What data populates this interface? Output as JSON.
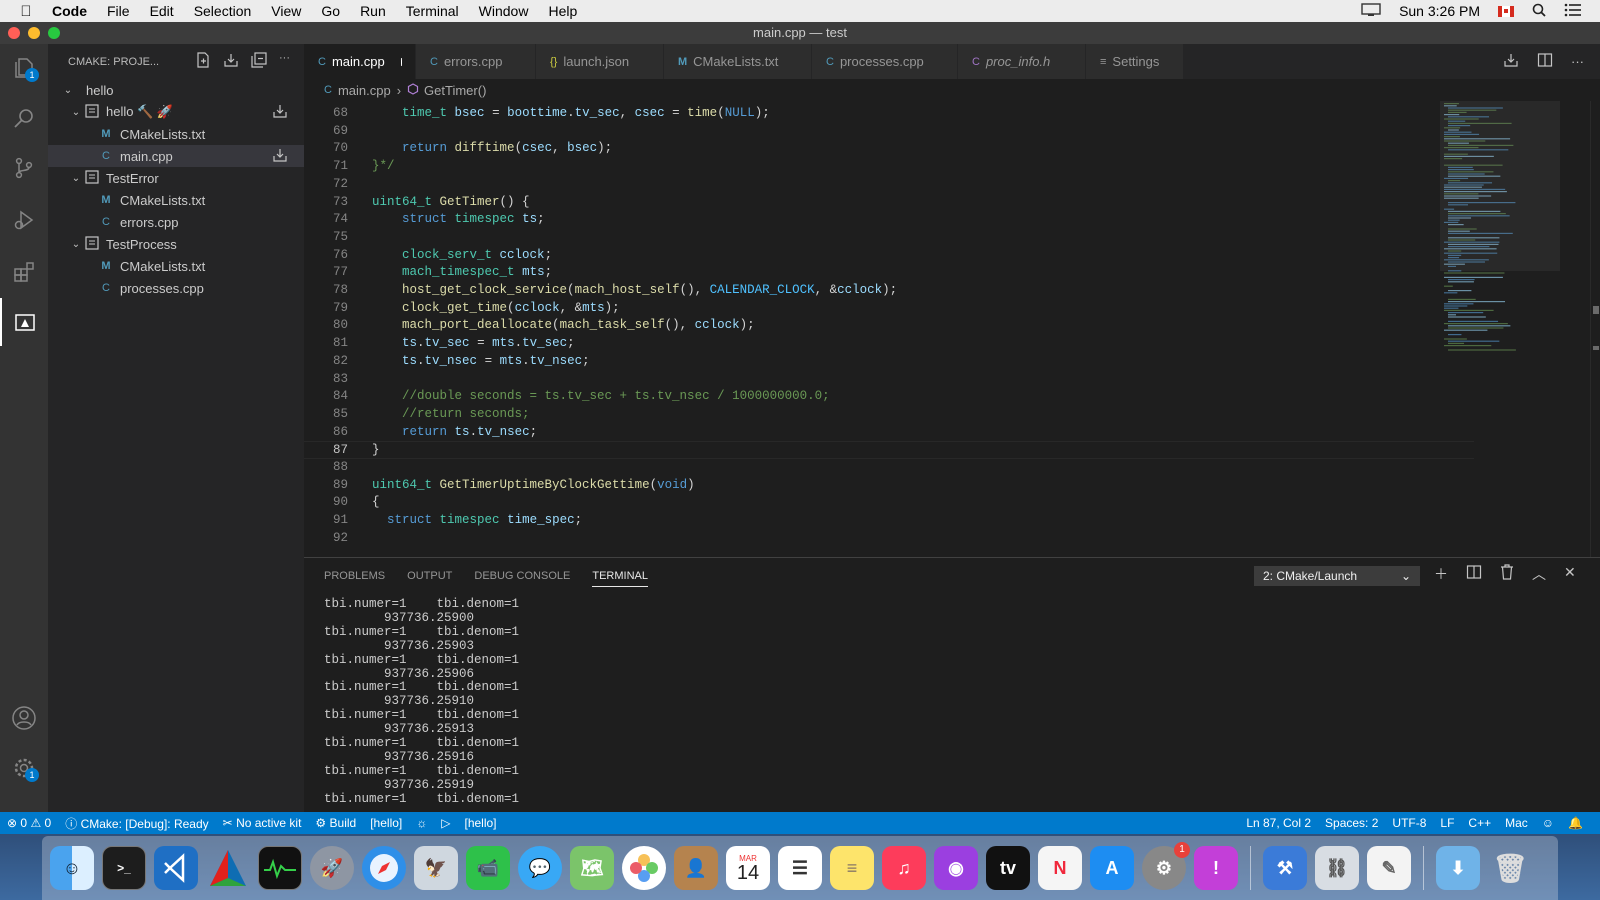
{
  "menubar": {
    "app": "Code",
    "items": [
      "File",
      "Edit",
      "Selection",
      "View",
      "Go",
      "Run",
      "Terminal",
      "Window",
      "Help"
    ],
    "clock": "Sun 3:26 PM"
  },
  "window": {
    "title": "main.cpp — test"
  },
  "activity": {
    "explorer_badge": "1",
    "settings_badge": "1"
  },
  "sidebar": {
    "title": "CMAKE: PROJE...",
    "tree": [
      {
        "label": "hello",
        "depth": 0,
        "chevron": "⌄",
        "icon": ""
      },
      {
        "label": "hello 🔨 🚀",
        "depth": 1,
        "chevron": "⌄",
        "icon": "project-icon"
      },
      {
        "label": "CMakeLists.txt",
        "depth": 2,
        "chevron": "",
        "icon": "M"
      },
      {
        "label": "main.cpp",
        "depth": 2,
        "chevron": "",
        "icon": "C"
      },
      {
        "label": "TestError",
        "depth": 1,
        "chevron": "⌄",
        "icon": "project-icon"
      },
      {
        "label": "CMakeLists.txt",
        "depth": 2,
        "chevron": "",
        "icon": "M"
      },
      {
        "label": "errors.cpp",
        "depth": 2,
        "chevron": "",
        "icon": "C"
      },
      {
        "label": "TestProcess",
        "depth": 1,
        "chevron": "⌄",
        "icon": "project-icon"
      },
      {
        "label": "CMakeLists.txt",
        "depth": 2,
        "chevron": "",
        "icon": "M"
      },
      {
        "label": "processes.cpp",
        "depth": 2,
        "chevron": "",
        "icon": "C"
      }
    ]
  },
  "tabs": [
    {
      "label": "main.cpp",
      "icon": "C",
      "active": true,
      "modified": true
    },
    {
      "label": "errors.cpp",
      "icon": "C"
    },
    {
      "label": "launch.json",
      "icon": "{}"
    },
    {
      "label": "CMakeLists.txt",
      "icon": "M"
    },
    {
      "label": "processes.cpp",
      "icon": "C"
    },
    {
      "label": "proc_info.h",
      "icon": "C"
    },
    {
      "label": "Settings",
      "icon": "≡"
    }
  ],
  "breadcrumb": {
    "file": "main.cpp",
    "symbol": "GetTimer()"
  },
  "editor": {
    "current_line": 87,
    "lines": [
      {
        "n": "68",
        "t": "    time_t bsec = boottime.tv_sec, csec = time(NULL);"
      },
      {
        "n": "69",
        "t": ""
      },
      {
        "n": "70",
        "t": "    return difftime(csec, bsec);"
      },
      {
        "n": "71",
        "t": "}*/"
      },
      {
        "n": "72",
        "t": ""
      },
      {
        "n": "73",
        "t": "uint64_t GetTimer() {"
      },
      {
        "n": "74",
        "t": "    struct timespec ts;"
      },
      {
        "n": "75",
        "t": ""
      },
      {
        "n": "76",
        "t": "    clock_serv_t cclock;"
      },
      {
        "n": "77",
        "t": "    mach_timespec_t mts;"
      },
      {
        "n": "78",
        "t": "    host_get_clock_service(mach_host_self(), CALENDAR_CLOCK, &cclock);"
      },
      {
        "n": "79",
        "t": "    clock_get_time(cclock, &mts);"
      },
      {
        "n": "80",
        "t": "    mach_port_deallocate(mach_task_self(), cclock);"
      },
      {
        "n": "81",
        "t": "    ts.tv_sec = mts.tv_sec;"
      },
      {
        "n": "82",
        "t": "    ts.tv_nsec = mts.tv_nsec;"
      },
      {
        "n": "83",
        "t": ""
      },
      {
        "n": "84",
        "t": "    //double seconds = ts.tv_sec + ts.tv_nsec / 1000000000.0;"
      },
      {
        "n": "85",
        "t": "    //return seconds;"
      },
      {
        "n": "86",
        "t": "    return ts.tv_nsec;"
      },
      {
        "n": "87",
        "t": "}"
      },
      {
        "n": "88",
        "t": ""
      },
      {
        "n": "89",
        "t": "uint64_t GetTimerUptimeByClockGettime(void)"
      },
      {
        "n": "90",
        "t": "{"
      },
      {
        "n": "91",
        "t": "  struct timespec time_spec;"
      },
      {
        "n": "92",
        "t": ""
      }
    ]
  },
  "panel": {
    "tabs": [
      "PROBLEMS",
      "OUTPUT",
      "DEBUG CONSOLE",
      "TERMINAL"
    ],
    "active_tab": "TERMINAL",
    "terminal_select": "2: CMake/Launch",
    "terminal_lines": [
      "tbi.numer=1    tbi.denom=1",
      "        937736.25900",
      "tbi.numer=1    tbi.denom=1",
      "        937736.25903",
      "tbi.numer=1    tbi.denom=1",
      "        937736.25906",
      "tbi.numer=1    tbi.denom=1",
      "        937736.25910",
      "tbi.numer=1    tbi.denom=1",
      "        937736.25913",
      "tbi.numer=1    tbi.denom=1",
      "        937736.25916",
      "tbi.numer=1    tbi.denom=1",
      "        937736.25919",
      "tbi.numer=1    tbi.denom=1"
    ]
  },
  "statusbar": {
    "errors": "0",
    "warnings": "0",
    "cmake_status": "CMake: [Debug]: Ready",
    "kit": "No active kit",
    "build": "Build",
    "target": "[hello]",
    "launch_target": "[hello]",
    "position": "Ln 87, Col 2",
    "spaces": "Spaces: 2",
    "encoding": "UTF-8",
    "eol": "LF",
    "language": "C++",
    "platform": "Mac"
  },
  "dock": {
    "calendar_month": "MAR",
    "calendar_day": "14",
    "settings_badge": "1"
  }
}
